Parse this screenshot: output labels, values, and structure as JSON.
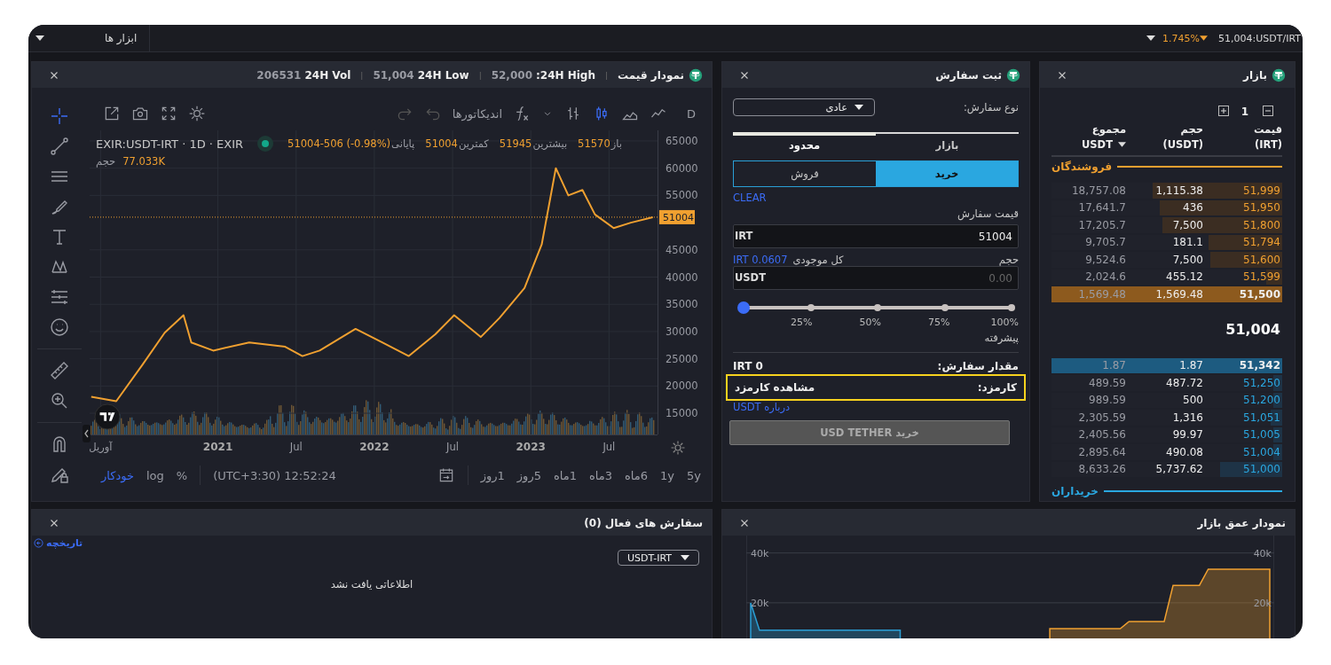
{
  "top_bar": {
    "market": "51,004:USDT/IRT",
    "change": "1.745%",
    "tools_menu": "ابزار ها"
  },
  "price_chart_panel": {
    "title": "نمودار قیمت",
    "stats": [
      {
        "separator": "|",
        "label": "24H High:",
        "value": "52,000"
      },
      {
        "separator": "|",
        "label": "24H Low",
        "value": "51,004"
      },
      {
        "separator": "|",
        "label": "24H Vol",
        "value": "206531"
      }
    ],
    "drawing_tools": [
      {
        "kind": "crosshair",
        "selected": true
      },
      {
        "kind": "trend-line",
        "selected": false
      },
      {
        "kind": "horizontal-lines",
        "selected": false
      },
      {
        "kind": "brush",
        "selected": false
      },
      {
        "kind": "text",
        "selected": false
      },
      {
        "kind": "pattern",
        "selected": false
      },
      {
        "kind": "fib",
        "selected": false
      },
      {
        "kind": "emoji",
        "selected": false
      },
      {
        "kind": "ruler",
        "selected": false
      },
      {
        "kind": "zoom",
        "selected": false
      },
      {
        "kind": "magnet",
        "selected": false
      },
      {
        "kind": "lock",
        "selected": false
      }
    ],
    "interval": "D",
    "chart_types": [
      {
        "kind": "line",
        "selected": false
      },
      {
        "kind": "area",
        "selected": false
      },
      {
        "kind": "candles",
        "selected": true
      },
      {
        "kind": "bars",
        "selected": false
      }
    ],
    "indicators": "اندیکاتورها",
    "symbol": "EXIR:USDT-IRT · 1D · EXIR",
    "ohlc": [
      {
        "label": "باز",
        "value": "51570"
      },
      {
        "label": "بیشترین",
        "value": "51945"
      },
      {
        "label": "کمترین",
        "value": "51004"
      },
      {
        "label": "پایانی",
        "value": "51004-506 (-0.98%)"
      }
    ],
    "volume_label": "حجم",
    "volume": "77.033K",
    "last_price": "51004",
    "chart_data": {
      "type": "line",
      "grid": true,
      "x": [
        2020.19,
        2020.35,
        2020.52,
        2020.66,
        2020.78,
        2020.83,
        2020.97,
        2021.2,
        2021.43,
        2021.54,
        2021.65,
        2021.88,
        2022.05,
        2022.22,
        2022.39,
        2022.51,
        2022.68,
        2022.8,
        2022.96,
        2023.07,
        2023.16,
        2023.24,
        2023.33,
        2023.41,
        2023.53,
        2023.64,
        2023.78
      ],
      "series": [
        {
          "color": "#f0a030",
          "values": [
            18000,
            17200,
            24000,
            29800,
            33000,
            28000,
            26500,
            28000,
            27200,
            25500,
            26500,
            30500,
            28000,
            25500,
            29500,
            33000,
            29000,
            32500,
            38000,
            46000,
            60000,
            55000,
            56000,
            51500,
            49000,
            50000,
            51000
          ]
        }
      ],
      "xlim": [
        2020.18,
        2023.81
      ],
      "ylim": [
        11100,
        66950
      ],
      "xticks": [
        {
          "value": 2020.25,
          "label": "آوریل"
        },
        {
          "value": 2021,
          "label": "2021"
        },
        {
          "value": 2021.5,
          "label": "Jul"
        },
        {
          "value": 2022,
          "label": "2022"
        },
        {
          "value": 2022.5,
          "label": "Jul"
        },
        {
          "value": 2023,
          "label": "2023"
        },
        {
          "value": 2023.5,
          "label": "Jul"
        }
      ],
      "yticks": [
        15000,
        20000,
        25000,
        30000,
        35000,
        40000,
        45000,
        55000,
        60000,
        65000
      ],
      "ref_lines": [
        {
          "axis": "y",
          "value": 51004,
          "color": "#f0a030"
        }
      ]
    },
    "ranges": [
      "5y",
      "1y",
      "6ماه",
      "3ماه",
      "1ماه",
      "5روز",
      "1روز"
    ],
    "clock": "(UTC+3:30) 12:52:24",
    "scale_options": [
      {
        "label": "%",
        "selected": false
      },
      {
        "label": "log",
        "selected": false
      },
      {
        "label": "خودکار",
        "selected": true
      }
    ]
  },
  "order_form": {
    "title": "ثبت سفارش",
    "order_type_label": "نوع سفارش:",
    "order_type": "عادی",
    "modes": [
      {
        "label": "بازار",
        "selected": false
      },
      {
        "label": "محدود",
        "selected": true
      }
    ],
    "sides": [
      {
        "label": "خرید",
        "selected": true
      },
      {
        "label": "فروش",
        "selected": false
      }
    ],
    "clear": "CLEAR",
    "price_label": "قیمت سفارش",
    "price": {
      "value": "51004",
      "unit": "IRT"
    },
    "amount_label": "حجم",
    "balance_label": "کل موجودی",
    "balance": "IRT 0.0607",
    "amount": {
      "placeholder": "0.00",
      "unit": "USDT"
    },
    "slider": {
      "level": 0,
      "marks": [
        "100%",
        "75%",
        "50%",
        "25%"
      ]
    },
    "advanced": "پیشرفته",
    "total_label": "مقدار سفارش:",
    "total": "IRT 0",
    "fee_label": "کارمزد:",
    "fee_link": "مشاهده کارمزد",
    "fee_highlighted": true,
    "about_link": "درباره USDT",
    "submit": {
      "label": "خرید USD TETHER",
      "disabled": true
    }
  },
  "order_book": {
    "title": "بازار",
    "precision": "1",
    "columns": [
      {
        "title": "قیمت",
        "unit": "(IRT)"
      },
      {
        "title": "حجم",
        "unit": "(USDT)"
      },
      {
        "title": "مجموع",
        "unit": "USDT"
      }
    ],
    "sellers_label": "فروشندگان",
    "asks": [
      {
        "price": "51,999",
        "volume": "1,115.38",
        "total": "18,757.08",
        "level": 0.56,
        "highlighted": false
      },
      {
        "price": "51,950",
        "volume": "436",
        "total": "17,641.7",
        "level": 0.53,
        "highlighted": false
      },
      {
        "price": "51,800",
        "volume": "7,500",
        "total": "17,205.7",
        "level": 0.52,
        "highlighted": false
      },
      {
        "price": "51,794",
        "volume": "181.1",
        "total": "9,705.7",
        "level": 0.32,
        "highlighted": false
      },
      {
        "price": "51,600",
        "volume": "7,500",
        "total": "9,524.6",
        "level": 0.31,
        "highlighted": false
      },
      {
        "price": "51,599",
        "volume": "455.12",
        "total": "2,024.6",
        "level": 0.07,
        "highlighted": false
      },
      {
        "price": "51,500",
        "volume": "1,569.48",
        "total": "1,569.48",
        "level": 1,
        "highlighted": true
      }
    ],
    "last_price": "51,004",
    "bids": [
      {
        "price": "51,342",
        "volume": "1.87",
        "total": "1.87",
        "level": 1,
        "highlighted": true
      },
      {
        "price": "51,250",
        "volume": "487.72",
        "total": "489.59",
        "level": 0.04,
        "highlighted": false
      },
      {
        "price": "51,200",
        "volume": "500",
        "total": "989.59",
        "level": 0.04,
        "highlighted": false
      },
      {
        "price": "51,051",
        "volume": "1,316",
        "total": "2,305.59",
        "level": 0.05,
        "highlighted": false
      },
      {
        "price": "51,005",
        "volume": "99.97",
        "total": "2,405.56",
        "level": 0.04,
        "highlighted": false
      },
      {
        "price": "51,004",
        "volume": "490.08",
        "total": "2,895.64",
        "level": 0.04,
        "highlighted": false
      },
      {
        "price": "51,000",
        "volume": "5,737.62",
        "total": "8,633.26",
        "level": 0.27,
        "highlighted": false
      }
    ],
    "buyers_label": "خریداران"
  },
  "active_orders": {
    "title": "سفارش های فعال (0)",
    "history_link": "تاریخچه",
    "market_filter": "USDT-IRT",
    "empty_message": "اطلاعاتی یافت نشد"
  },
  "depth_chart_panel": {
    "title": "نمودار عمق بازار",
    "right_axis_labels": [
      "40k",
      "20k"
    ],
    "chart_data": {
      "type": "area",
      "categories": [
        null,
        null,
        null,
        null,
        null,
        null,
        null,
        null,
        null,
        null,
        null,
        null,
        null,
        null,
        null,
        null,
        null,
        null,
        null,
        null,
        null,
        null,
        null,
        null,
        null,
        null,
        null,
        null,
        null,
        null,
        null,
        null,
        null,
        null,
        null,
        null,
        null,
        null,
        null,
        null,
        null,
        null,
        null,
        null,
        null,
        null,
        null,
        null,
        null,
        null,
        null,
        null,
        null,
        null,
        null,
        null,
        null,
        null,
        null,
        null
      ],
      "series": [
        {
          "color": "#2a9fd6",
          "values": [
            20000,
            9000,
            9000,
            9000,
            9000,
            9000,
            9000,
            9000,
            9000,
            9000,
            9000,
            9000,
            9000,
            9000,
            9000,
            9000,
            9000,
            9000,
            null,
            null,
            null,
            null,
            null,
            null,
            null,
            null,
            null,
            null,
            null,
            null,
            null,
            null,
            null,
            null,
            null,
            null,
            null,
            null,
            null,
            null,
            null,
            null,
            null,
            null,
            null,
            null,
            null,
            null,
            null,
            null,
            null,
            null,
            null,
            null,
            null,
            null,
            null,
            null,
            null,
            null
          ]
        },
        {
          "color": "#f0a030",
          "values": [
            null,
            null,
            null,
            null,
            null,
            null,
            null,
            null,
            null,
            null,
            null,
            null,
            null,
            null,
            null,
            null,
            null,
            null,
            null,
            null,
            null,
            null,
            null,
            null,
            null,
            null,
            null,
            null,
            null,
            null,
            null,
            null,
            null,
            null,
            9600,
            9600,
            9600,
            9600,
            9600,
            9600,
            9600,
            9600,
            9600,
            12500,
            12500,
            12500,
            12500,
            12500,
            27000,
            27000,
            27000,
            27000,
            33500,
            33500,
            33500,
            33500,
            33500,
            33500,
            33500,
            33500
          ]
        }
      ],
      "ylim": [
        5000,
        47000
      ],
      "yticks": [
        {
          "value": 40000,
          "label": "40k"
        },
        {
          "value": 20000,
          "label": "20k"
        }
      ]
    }
  }
}
